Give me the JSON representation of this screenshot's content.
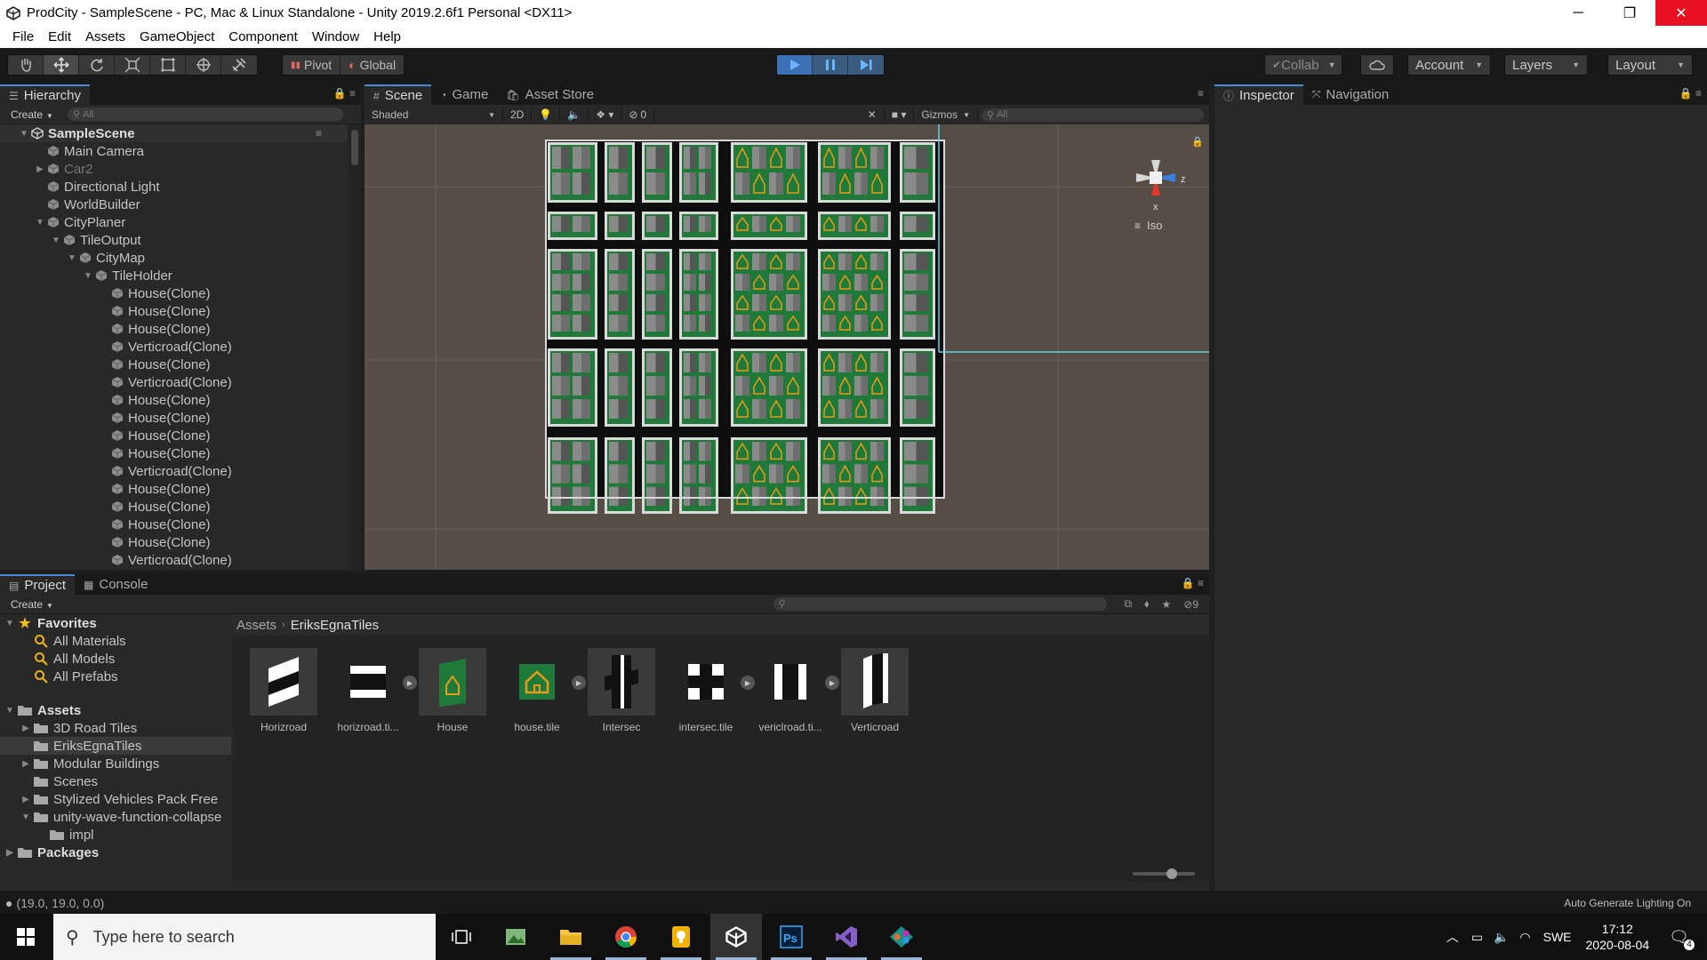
{
  "window": {
    "title": "ProdCity - SampleScene - PC, Mac & Linux Standalone - Unity 2019.2.6f1 Personal <DX11>",
    "minimize": "─",
    "maximize": "❐",
    "close": "✕"
  },
  "menu": [
    "File",
    "Edit",
    "Assets",
    "GameObject",
    "Component",
    "Window",
    "Help"
  ],
  "toolbar": {
    "pivot": "Pivot",
    "global": "Global",
    "collab": "Collab",
    "account": "Account",
    "layers": "Layers",
    "layout": "Layout"
  },
  "hierarchy": {
    "tab": "Hierarchy",
    "create": "Create",
    "search_placeholder": "All",
    "scene": "SampleScene",
    "items": [
      {
        "label": "Main Camera",
        "level": 1,
        "arrow": ""
      },
      {
        "label": "Car2",
        "level": 1,
        "arrow": "▶",
        "dim": true
      },
      {
        "label": "Directional Light",
        "level": 1,
        "arrow": ""
      },
      {
        "label": "WorldBuilder",
        "level": 1,
        "arrow": ""
      },
      {
        "label": "CityPlaner",
        "level": 1,
        "arrow": "▼"
      },
      {
        "label": "TileOutput",
        "level": 2,
        "arrow": "▼"
      },
      {
        "label": "CityMap",
        "level": 3,
        "arrow": "▼"
      },
      {
        "label": "TileHolder",
        "level": 4,
        "arrow": "▼"
      },
      {
        "label": "House(Clone)",
        "level": 5,
        "arrow": ""
      },
      {
        "label": "House(Clone)",
        "level": 5,
        "arrow": ""
      },
      {
        "label": "House(Clone)",
        "level": 5,
        "arrow": ""
      },
      {
        "label": "Verticroad(Clone)",
        "level": 5,
        "arrow": ""
      },
      {
        "label": "House(Clone)",
        "level": 5,
        "arrow": ""
      },
      {
        "label": "Verticroad(Clone)",
        "level": 5,
        "arrow": ""
      },
      {
        "label": "House(Clone)",
        "level": 5,
        "arrow": ""
      },
      {
        "label": "House(Clone)",
        "level": 5,
        "arrow": ""
      },
      {
        "label": "House(Clone)",
        "level": 5,
        "arrow": ""
      },
      {
        "label": "House(Clone)",
        "level": 5,
        "arrow": ""
      },
      {
        "label": "Verticroad(Clone)",
        "level": 5,
        "arrow": ""
      },
      {
        "label": "House(Clone)",
        "level": 5,
        "arrow": ""
      },
      {
        "label": "House(Clone)",
        "level": 5,
        "arrow": ""
      },
      {
        "label": "House(Clone)",
        "level": 5,
        "arrow": ""
      },
      {
        "label": "House(Clone)",
        "level": 5,
        "arrow": ""
      },
      {
        "label": "Verticroad(Clone)",
        "level": 5,
        "arrow": ""
      }
    ]
  },
  "scene": {
    "tabs": [
      "Scene",
      "Game",
      "Asset Store"
    ],
    "shaded": "Shaded",
    "mode_2d": "2D",
    "fx_count": "0",
    "gizmos": "Gizmos",
    "search_placeholder": "All",
    "gizmo_label": "Iso",
    "axis_x": "x",
    "axis_z": "z"
  },
  "inspector": {
    "tabs": [
      "Inspector",
      "Navigation"
    ]
  },
  "project": {
    "tabs": [
      "Project",
      "Console"
    ],
    "create": "Create",
    "hidden_count": "9",
    "favorites": {
      "label": "Favorites",
      "items": [
        "All Materials",
        "All Models",
        "All Prefabs"
      ]
    },
    "assets_root": "Assets",
    "asset_folders": [
      {
        "label": "3D Road Tiles",
        "arrow": "▶",
        "level": 1
      },
      {
        "label": "EriksEgnaTiles",
        "arrow": "",
        "level": 1,
        "selected": true
      },
      {
        "label": "Modular Buildings",
        "arrow": "▶",
        "level": 1
      },
      {
        "label": "Scenes",
        "arrow": "",
        "level": 1
      },
      {
        "label": "Stylized Vehicles Pack Free",
        "arrow": "▶",
        "level": 1
      },
      {
        "label": "unity-wave-function-collapse",
        "arrow": "▼",
        "level": 1
      },
      {
        "label": "impl",
        "arrow": "",
        "level": 2
      }
    ],
    "packages": "Packages",
    "breadcrumb": [
      "Assets",
      "EriksEgnaTiles"
    ],
    "assets": [
      "Horizroad",
      "horizroad.ti...",
      "House",
      "house.tile",
      "Intersec",
      "intersec.tile",
      "vericlroad.ti...",
      "Verticroad"
    ]
  },
  "status": {
    "coords": "(19.0, 19.0, 0.0)",
    "lighting": "Auto Generate Lighting On"
  },
  "taskbar": {
    "search_placeholder": "Type here to search",
    "lang": "SWE",
    "time": "17:12",
    "date": "2020-08-04",
    "notifications": "4"
  },
  "colors": {
    "accent": "#4a8ad6",
    "play": "#3c6fb4",
    "scene_bg": "#574d47",
    "grass": "#1f7a3a",
    "gizmo_red": "#e0392b",
    "gizmo_blue": "#3a7ddb"
  }
}
